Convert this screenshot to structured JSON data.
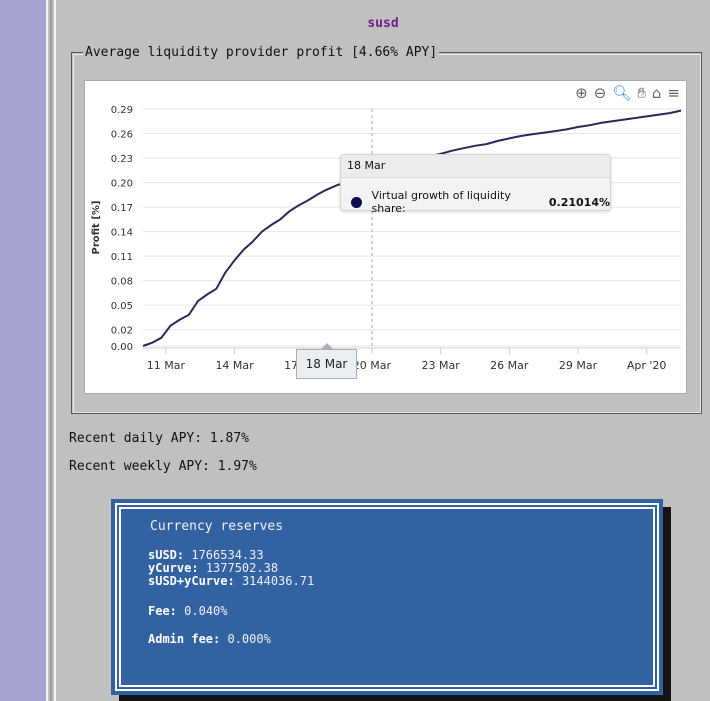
{
  "pool_name": "susd",
  "fieldset_legend": "Average liquidity provider profit [4.66% APY]",
  "toolbar": [
    "zoom-in-icon",
    "zoom-out-icon",
    "magnify-icon",
    "pan-hand-icon",
    "home-icon",
    "menu-icon"
  ],
  "tooltip": {
    "date": "18 Mar",
    "series_label": "Virtual growth of liquidity share:",
    "value": "0.21014%"
  },
  "crosshair_label": "18 Mar",
  "chart_data": {
    "type": "line",
    "ylabel": "Profit [%]",
    "xlabel": "",
    "ylim": [
      0.0,
      0.29
    ],
    "yticks": [
      "0.29",
      "0.26",
      "0.23",
      "0.20",
      "0.17",
      "0.14",
      "0.11",
      "0.08",
      "0.05",
      "0.02",
      "0.00"
    ],
    "xticks": [
      "11 Mar",
      "14 Mar",
      "17 Mar",
      "20 Mar",
      "23 Mar",
      "26 Mar",
      "29 Mar",
      "Apr '20"
    ],
    "x_days": [
      0.0,
      0.4,
      0.8,
      1.2,
      1.6,
      2.0,
      2.4,
      2.8,
      3.2,
      3.6,
      4.0,
      4.4,
      4.8,
      5.2,
      5.6,
      6.0,
      6.4,
      6.8,
      7.2,
      7.6,
      8.0,
      8.5,
      9.0,
      9.5,
      10.0,
      10.5,
      11.0,
      11.5,
      12.0,
      12.5,
      13.0,
      13.5,
      14.0,
      14.5,
      15.0,
      15.5,
      16.0,
      16.5,
      17.0,
      17.5,
      18.0,
      18.5,
      19.0,
      19.5,
      20.0,
      20.5,
      21.0,
      21.5,
      22.0,
      22.5,
      23.0,
      23.5
    ],
    "values": [
      0.0,
      0.004,
      0.01,
      0.025,
      0.032,
      0.038,
      0.055,
      0.063,
      0.07,
      0.09,
      0.105,
      0.118,
      0.128,
      0.14,
      0.148,
      0.155,
      0.165,
      0.172,
      0.178,
      0.185,
      0.191,
      0.197,
      0.201,
      0.206,
      0.21,
      0.214,
      0.219,
      0.222,
      0.226,
      0.232,
      0.235,
      0.239,
      0.242,
      0.245,
      0.247,
      0.251,
      0.254,
      0.257,
      0.259,
      0.261,
      0.263,
      0.265,
      0.268,
      0.27,
      0.273,
      0.275,
      0.277,
      0.279,
      0.281,
      0.283,
      0.285,
      0.288
    ],
    "highlight_index": 24,
    "color": "#2a2a5a",
    "grid": true
  },
  "stats": {
    "daily": "Recent daily APY: 1.87%",
    "weekly": "Recent weekly APY: 1.97%"
  },
  "reserves": {
    "title": "Currency reserves",
    "items": [
      {
        "label": "sUSD:",
        "value": "1766534.33"
      },
      {
        "label": "yCurve:",
        "value": "1377502.38"
      },
      {
        "label": "sUSD+yCurve:",
        "value": "3144036.71"
      }
    ],
    "fee_label": "Fee:",
    "fee_value": "0.040%",
    "admin_fee_label": "Admin fee:",
    "admin_fee_value": "0.000%"
  },
  "colors": {
    "page_bg": "#c0c0c0",
    "sidebar": "#a6a3cf",
    "title": "#6b1f8a",
    "reserves_bg": "#3362a3"
  }
}
